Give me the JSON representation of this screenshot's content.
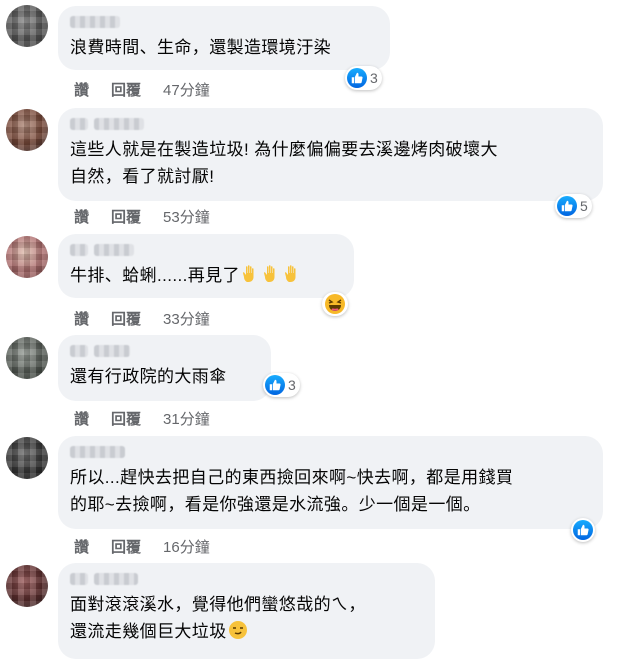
{
  "ui": {
    "accent": "#1877f2",
    "bubble_bg": "#f0f2f5",
    "meta_color": "#65676b"
  },
  "comments": [
    {
      "text": "浪費時間、生命，還製造環境汙染",
      "actions": {
        "like": "讚",
        "reply": "回覆",
        "time": "47分鐘"
      },
      "reaction_count": "3",
      "reaction_icon": "like-icon"
    },
    {
      "text": "這些人就是在製造垃圾! 為什麼偏偏要去溪邊烤肉破壞大\n自然，看了就討厭!",
      "actions": {
        "like": "讚",
        "reply": "回覆",
        "time": "53分鐘"
      },
      "reaction_count": "5",
      "reaction_icon": "like-icon"
    },
    {
      "text": "牛排、蛤蜊......再見了",
      "emoji": [
        "raised-hand-emoji",
        "raised-hand-emoji",
        "raised-hand-emoji"
      ],
      "actions": {
        "like": "讚",
        "reply": "回覆",
        "time": "33分鐘"
      },
      "reaction_icon": "haha-icon"
    },
    {
      "text": "還有行政院的大雨傘",
      "actions": {
        "like": "讚",
        "reply": "回覆",
        "time": "31分鐘"
      },
      "reaction_count": "3",
      "reaction_icon": "like-icon"
    },
    {
      "text": "所以...趕快去把自己的東西撿回來啊~快去啊，都是用錢買\n的耶~去撿啊，看是你強還是水流強。少一個是一個。",
      "actions": {
        "like": "讚",
        "reply": "回覆",
        "time": "16分鐘"
      },
      "reaction_icon": "like-icon"
    },
    {
      "text": "面對滾滾溪水，覺得他們蠻悠哉的ㄟ，\n還流走幾個巨大垃圾",
      "emoji": [
        "smirk-emoji"
      ]
    }
  ]
}
